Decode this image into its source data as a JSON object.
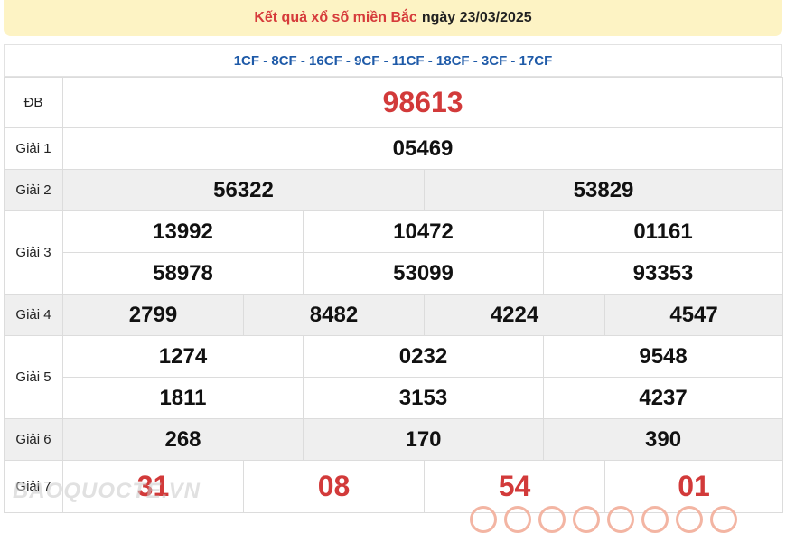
{
  "header": {
    "link_text": "Kết quả xổ số miền Bắc",
    "date_text": "ngày 23/03/2025"
  },
  "codes": "1CF - 8CF - 16CF - 9CF - 11CF - 18CF - 3CF - 17CF",
  "prizes": {
    "db": {
      "label": "ĐB",
      "values": [
        "98613"
      ]
    },
    "g1": {
      "label": "Giải 1",
      "values": [
        "05469"
      ]
    },
    "g2": {
      "label": "Giải 2",
      "values": [
        "56322",
        "53829"
      ]
    },
    "g3": {
      "label": "Giải 3",
      "values": [
        "13992",
        "10472",
        "01161",
        "58978",
        "53099",
        "93353"
      ]
    },
    "g4": {
      "label": "Giải 4",
      "values": [
        "2799",
        "8482",
        "4224",
        "4547"
      ]
    },
    "g5": {
      "label": "Giải 5",
      "values": [
        "1274",
        "0232",
        "9548",
        "1811",
        "3153",
        "4237"
      ]
    },
    "g6": {
      "label": "Giải 6",
      "values": [
        "268",
        "170",
        "390"
      ]
    },
    "g7": {
      "label": "Giải 7",
      "values": [
        "31",
        "08",
        "54",
        "01"
      ]
    }
  },
  "watermark": "BAOQUOCTE.VN"
}
